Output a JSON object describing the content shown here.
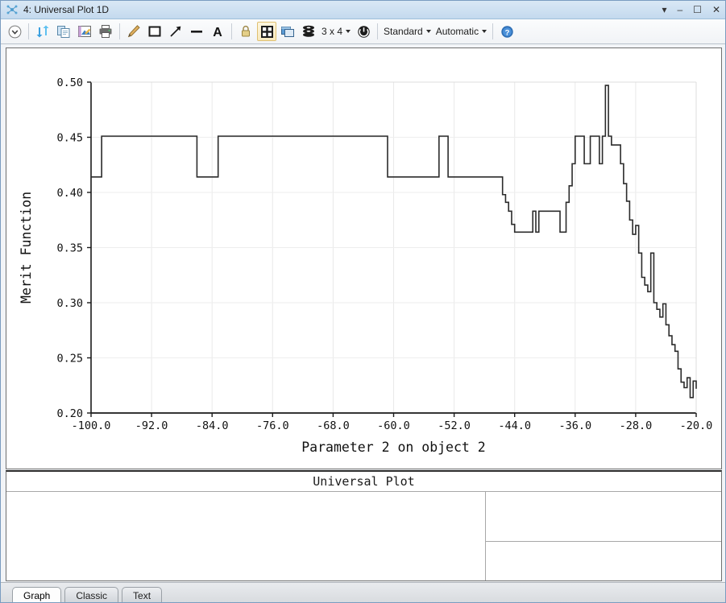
{
  "window": {
    "title": "4: Universal Plot 1D",
    "icon": "plot-window-icon",
    "buttons": {
      "dropdown": "▾",
      "minimize": "–",
      "maximize": "☐",
      "close": "✕"
    }
  },
  "toolbar": {
    "items": [
      {
        "name": "expand-options-button",
        "icon": "chevron-down-circle-icon",
        "label": ""
      },
      {
        "name": "refresh-button",
        "icon": "refresh-arrows-icon",
        "label": ""
      },
      {
        "name": "copy-button",
        "icon": "copy-clipboard-icon",
        "label": ""
      },
      {
        "name": "save-image-button",
        "icon": "save-image-icon",
        "label": ""
      },
      {
        "name": "print-button",
        "icon": "printer-icon",
        "label": ""
      },
      {
        "name": "annotate-pencil-button",
        "icon": "pencil-icon",
        "label": ""
      },
      {
        "name": "draw-rectangle-button",
        "icon": "rectangle-icon",
        "label": ""
      },
      {
        "name": "draw-arrow-button",
        "icon": "arrow-icon",
        "label": ""
      },
      {
        "name": "draw-line-button",
        "icon": "line-icon",
        "label": ""
      },
      {
        "name": "text-annotation-button",
        "icon": "text-a-icon",
        "label": ""
      },
      {
        "name": "lock-button",
        "icon": "lock-icon",
        "label": ""
      },
      {
        "name": "fit-to-window-button",
        "icon": "fit-window-icon",
        "label": "",
        "selected": true
      },
      {
        "name": "detach-window-button",
        "icon": "detach-window-icon",
        "label": ""
      },
      {
        "name": "layers-button",
        "icon": "layers-stack-icon",
        "label": ""
      }
    ],
    "grid_label": "3 x 4",
    "refresh_cycle_icon": "refresh-cycle-icon",
    "style_dropdown": "Standard",
    "update_dropdown": "Automatic",
    "help_icon": "help-circle-icon"
  },
  "chart_data": {
    "type": "line",
    "title": "",
    "xlabel": "Parameter 2 on object 2",
    "ylabel": "Merit Function",
    "xlim": [
      -100.0,
      -20.0
    ],
    "ylim": [
      0.2,
      0.5
    ],
    "xticks": [
      "-100.0",
      "-92.0",
      "-84.0",
      "-76.0",
      "-68.0",
      "-60.0",
      "-52.0",
      "-44.0",
      "-36.0",
      "-28.0",
      "-20.0"
    ],
    "xtick_values": [
      -100,
      -92,
      -84,
      -76,
      -68,
      -60,
      -52,
      -44,
      -36,
      -28,
      -20
    ],
    "yticks": [
      "0.50",
      "0.45",
      "0.40",
      "0.35",
      "0.30",
      "0.25",
      "0.20"
    ],
    "ytick_values": [
      0.5,
      0.45,
      0.4,
      0.35,
      0.3,
      0.25,
      0.2
    ],
    "grid": true,
    "legend": false,
    "line_color": "#2b2b2b",
    "series": [
      {
        "name": "Merit Function",
        "x": [
          -100.0,
          -99.6,
          -99.2,
          -98.8,
          -98.6,
          -98.4,
          -98.0,
          -96.0,
          -94.0,
          -92.0,
          -90.0,
          -88.0,
          -86.4,
          -86.0,
          -85.6,
          -85.2,
          -84.8,
          -84.4,
          -84.0,
          -83.6,
          -83.2,
          -82.8,
          -82.4,
          -82.0,
          -80.0,
          -78.0,
          -76.0,
          -74.0,
          -72.0,
          -70.0,
          -68.0,
          -66.0,
          -64.0,
          -62.0,
          -61.2,
          -60.8,
          -60.4,
          -60.0,
          -59.6,
          -59.2,
          -58.8,
          -58.0,
          -57.0,
          -56.0,
          -55.0,
          -54.4,
          -54.0,
          -53.6,
          -53.2,
          -52.8,
          -52.4,
          -52.0,
          -51.6,
          -51.2,
          -50.8,
          -50.4,
          -50.0,
          -49.0,
          -48.0,
          -47.0,
          -46.4,
          -46.0,
          -45.6,
          -45.2,
          -44.8,
          -44.4,
          -44.0,
          -43.6,
          -43.2,
          -42.8,
          -42.4,
          -42.0,
          -41.6,
          -41.2,
          -40.8,
          -40.4,
          -40.0,
          -39.6,
          -39.2,
          -38.8,
          -38.4,
          -38.0,
          -37.6,
          -37.2,
          -36.8,
          -36.4,
          -36.0,
          -35.6,
          -35.2,
          -34.8,
          -34.4,
          -34.0,
          -33.6,
          -33.2,
          -32.8,
          -32.4,
          -32.0,
          -31.6,
          -31.2,
          -30.8,
          -30.4,
          -30.0,
          -29.6,
          -29.2,
          -28.8,
          -28.4,
          -28.0,
          -27.6,
          -27.2,
          -26.8,
          -26.4,
          -26.0,
          -25.6,
          -25.2,
          -24.8,
          -24.4,
          -24.0,
          -23.6,
          -23.2,
          -22.8,
          -22.4,
          -22.0,
          -21.6,
          -21.2,
          -20.8,
          -20.4,
          -20.0
        ],
        "y": [
          0.414,
          0.414,
          0.414,
          0.414,
          0.451,
          0.451,
          0.451,
          0.451,
          0.451,
          0.451,
          0.451,
          0.451,
          0.451,
          0.414,
          0.414,
          0.414,
          0.414,
          0.414,
          0.414,
          0.414,
          0.451,
          0.451,
          0.451,
          0.451,
          0.451,
          0.451,
          0.451,
          0.451,
          0.451,
          0.451,
          0.451,
          0.451,
          0.451,
          0.451,
          0.451,
          0.414,
          0.414,
          0.414,
          0.414,
          0.414,
          0.414,
          0.414,
          0.414,
          0.414,
          0.414,
          0.414,
          0.451,
          0.451,
          0.451,
          0.414,
          0.414,
          0.414,
          0.414,
          0.414,
          0.414,
          0.414,
          0.414,
          0.414,
          0.414,
          0.414,
          0.414,
          0.414,
          0.398,
          0.391,
          0.383,
          0.371,
          0.364,
          0.364,
          0.364,
          0.364,
          0.364,
          0.364,
          0.383,
          0.364,
          0.383,
          0.383,
          0.383,
          0.383,
          0.383,
          0.383,
          0.383,
          0.364,
          0.364,
          0.391,
          0.406,
          0.426,
          0.451,
          0.451,
          0.451,
          0.426,
          0.426,
          0.451,
          0.451,
          0.451,
          0.426,
          0.451,
          0.497,
          0.451,
          0.443,
          0.443,
          0.443,
          0.426,
          0.408,
          0.392,
          0.375,
          0.362,
          0.37,
          0.345,
          0.323,
          0.316,
          0.31,
          0.345,
          0.3,
          0.294,
          0.287,
          0.299,
          0.28,
          0.27,
          0.262,
          0.256,
          0.24,
          0.228,
          0.223,
          0.232,
          0.214,
          0.229,
          0.222
        ]
      }
    ]
  },
  "info_panel": {
    "title": "Universal Plot",
    "cells": []
  },
  "tabs": [
    {
      "label": "Graph",
      "active": true
    },
    {
      "label": "Classic",
      "active": false
    },
    {
      "label": "Text",
      "active": false
    }
  ],
  "colors": {
    "titlebar": "#cfe1f2",
    "accent": "#2b2b2b",
    "grid": "#e8e8e8",
    "axis": "#1a1a1a"
  }
}
